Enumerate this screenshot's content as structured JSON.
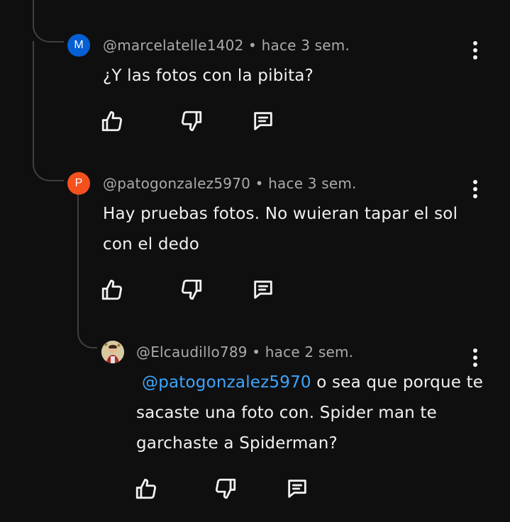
{
  "comments": [
    {
      "avatar_letter": "M",
      "avatar_color": "#065fd4",
      "meta": "@marcelatelle1402 • hace 3 sem.",
      "text": "¿Y las fotos con la pibita?"
    },
    {
      "avatar_letter": "P",
      "avatar_color": "#f4511e",
      "meta": "@patogonzalez5970 • hace 3 sem.",
      "text": "Hay pruebas fotos. No wuieran tapar el sol con el dedo"
    },
    {
      "avatar_letter": "",
      "avatar_color": "#c9b37a",
      "meta": "@Elcaudillo789 • hace 2 sem.",
      "mention": "@patogonzalez5970",
      "text": " o sea que porque te sacaste una foto con. Spider man te garchaste a Spiderman?"
    }
  ],
  "icons": {
    "like": "thumb-up-icon",
    "dislike": "thumb-down-icon",
    "reply": "reply-icon",
    "more": "more-vertical-icon"
  },
  "colors": {
    "background": "#0f0f0f",
    "text": "#f1f1f1",
    "meta": "#aaaaaa",
    "mention": "#3ea6ff",
    "thread_line": "#3f3f3f"
  }
}
